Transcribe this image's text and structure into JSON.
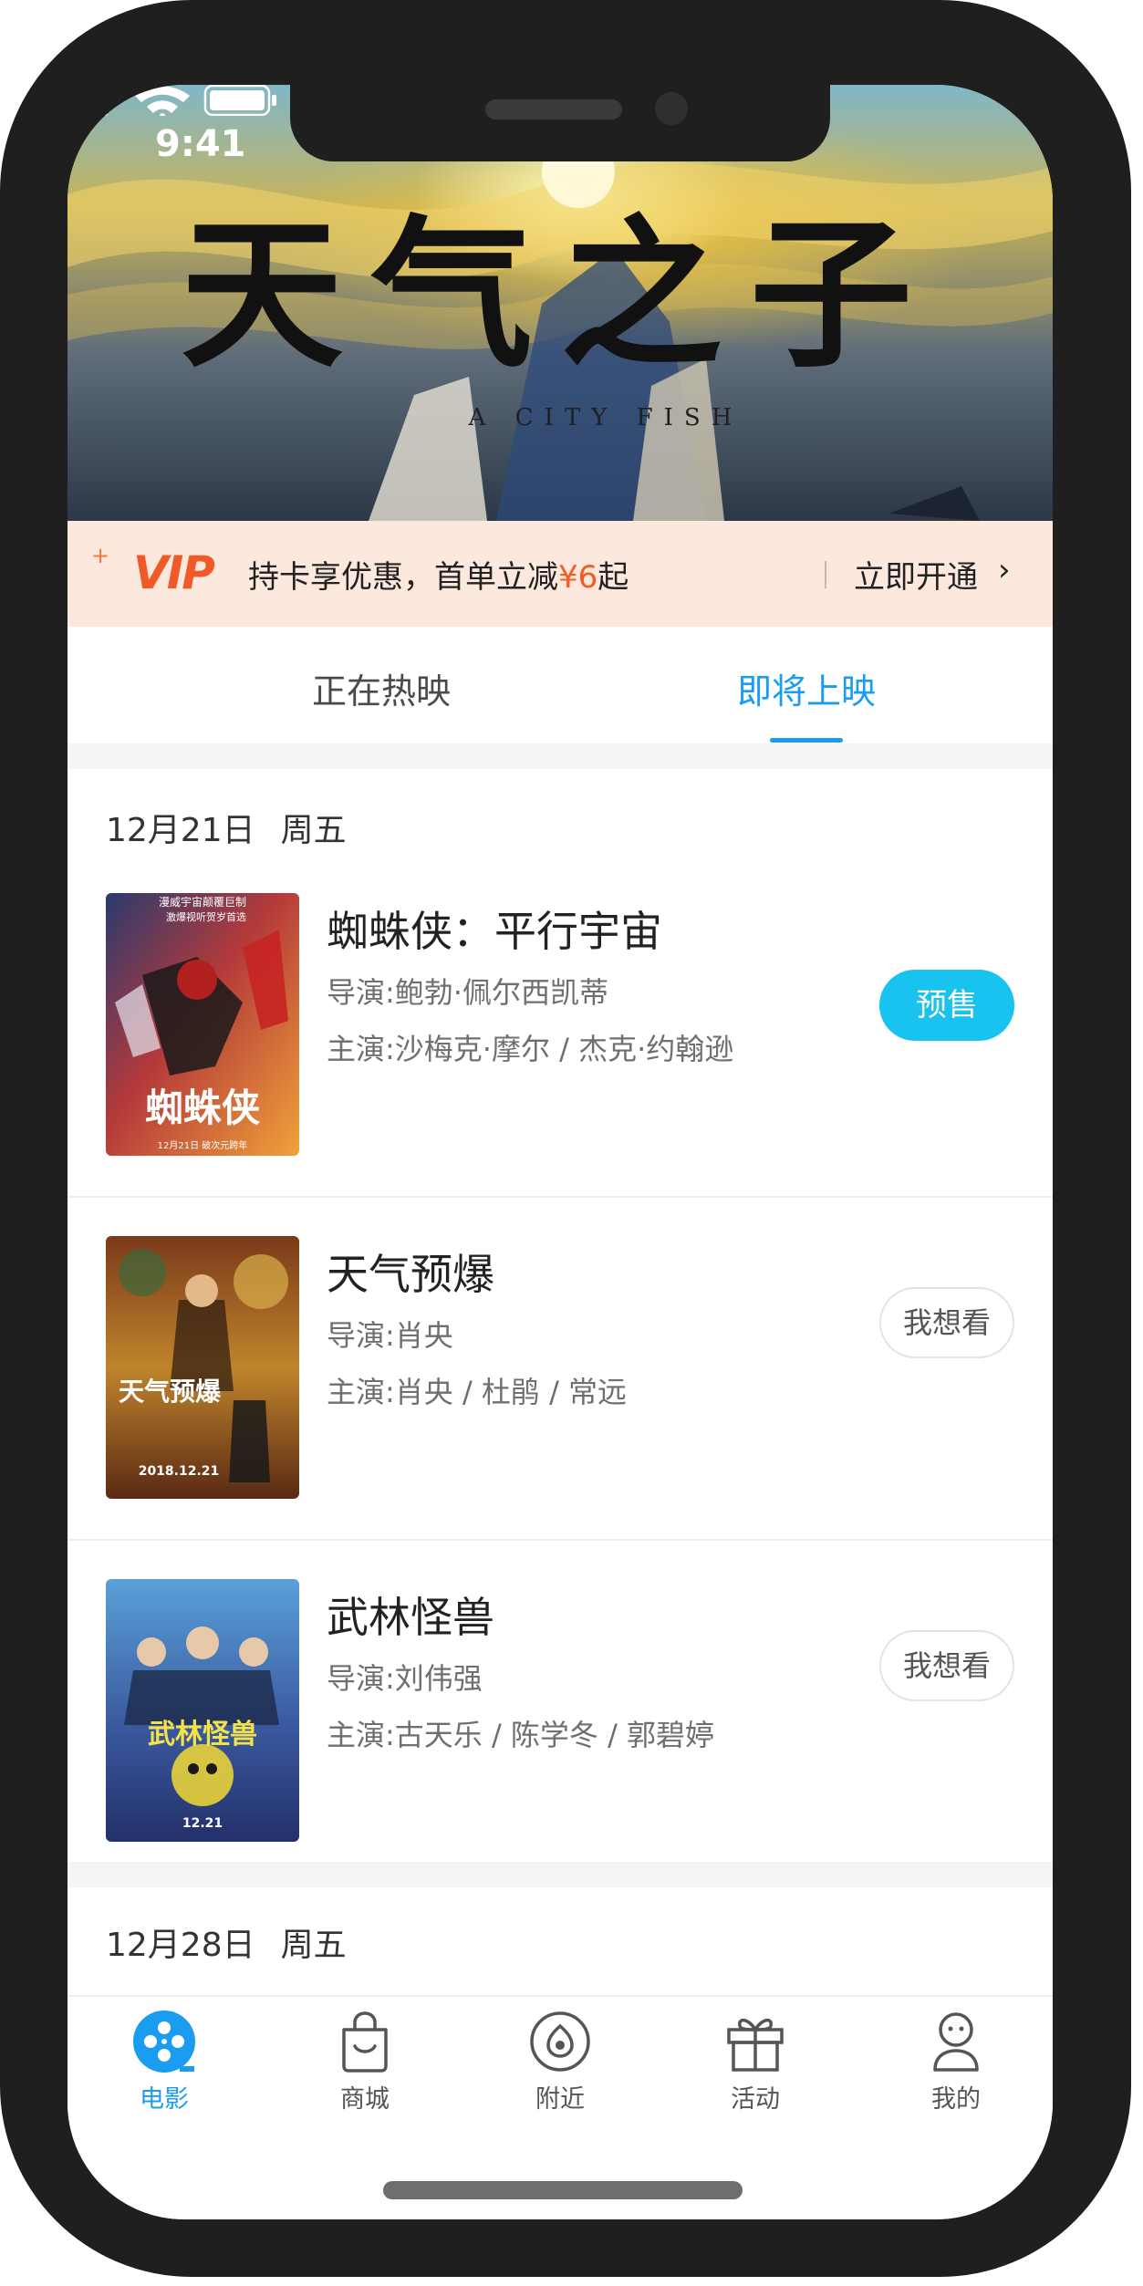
{
  "status_bar": {
    "time": "9:41"
  },
  "banner": {
    "title": "天气之子",
    "subtitle": "A CITY FISH"
  },
  "vip": {
    "logo": "VIP",
    "text_prefix": "持卡享优惠，首单立减",
    "amount": "¥6",
    "text_suffix": "起",
    "cta": "立即开通",
    "accent_color": "#f25b23"
  },
  "tabs": [
    {
      "label": "正在热映",
      "active": false
    },
    {
      "label": "即将上映",
      "active": true
    }
  ],
  "sections": [
    {
      "date": "12月21日",
      "weekday": "周五",
      "movies": [
        {
          "title": "蜘蛛侠：平行宇宙",
          "director": "导演:鲍勃·佩尔西凯蒂",
          "actors": "主演:沙梅克·摩尔 / 杰克·约翰逊",
          "action": "预售",
          "action_type": "presale",
          "poster_text": "蜘蛛侠",
          "poster_top": "漫威宇宙颠覆巨制",
          "poster_line2": "激爆视听贺岁首选",
          "poster_date": "12月21日 破次元跨年"
        },
        {
          "title": "天气预爆",
          "director": "导演:肖央",
          "actors": "主演:肖央 / 杜鹃 / 常远",
          "action": "我想看",
          "action_type": "want",
          "poster_text": "天气预爆",
          "poster_date": "2018.12.21"
        },
        {
          "title": "武林怪兽",
          "director": "导演:刘伟强",
          "actors": "主演:古天乐 / 陈学冬 / 郭碧婷",
          "action": "我想看",
          "action_type": "want",
          "poster_text": "武林怪兽",
          "poster_date": "12.21"
        }
      ]
    },
    {
      "date": "12月28日",
      "weekday": "周五",
      "movies": []
    }
  ],
  "tabbar": [
    {
      "label": "电影",
      "icon": "film-reel-icon",
      "active": true
    },
    {
      "label": "商城",
      "icon": "shopping-bag-icon",
      "active": false
    },
    {
      "label": "附近",
      "icon": "location-pin-icon",
      "active": false
    },
    {
      "label": "活动",
      "icon": "gift-icon",
      "active": false
    },
    {
      "label": "我的",
      "icon": "user-icon",
      "active": false
    }
  ],
  "colors": {
    "accent": "#1a9cf0",
    "presale": "#18c3ef",
    "vip_bg": "#fde8dd"
  }
}
